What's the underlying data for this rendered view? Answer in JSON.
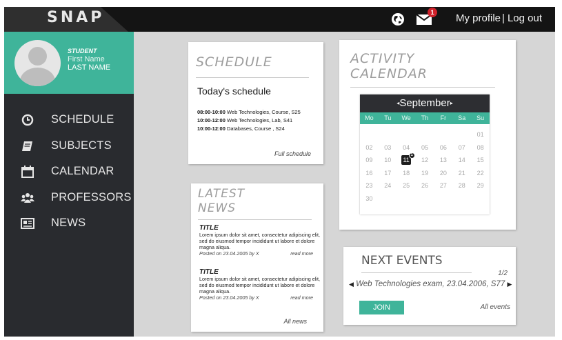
{
  "header": {
    "logo": "SNAP",
    "notifications_count": "1",
    "my_profile": "My profile",
    "separator": "|",
    "logout": "Log out"
  },
  "profile": {
    "role": "STUDENT",
    "first_name": "First Name",
    "last_name": "LAST NAME"
  },
  "sidebar": {
    "items": [
      {
        "label": "SCHEDULE",
        "icon": "clock-icon"
      },
      {
        "label": "SUBJECTS",
        "icon": "book-icon"
      },
      {
        "label": "CALENDAR",
        "icon": "calendar-icon"
      },
      {
        "label": "PROFESSORS",
        "icon": "people-icon"
      },
      {
        "label": "NEWS",
        "icon": "newspaper-icon"
      }
    ]
  },
  "schedule": {
    "title": "SCHEDULE",
    "subtitle": "Today's schedule",
    "entries": [
      {
        "time": "08:00-10:00",
        "text": " Web Technologies, Course, S25"
      },
      {
        "time": "10:00-12:00",
        "text": " Web Technologies, Lab, S41"
      },
      {
        "time": "10:00-12:00",
        "text": " Databases, Course , S24"
      }
    ],
    "link": "Full schedule"
  },
  "news": {
    "title_line1": "LATEST",
    "title_line2": "NEWS",
    "items": [
      {
        "title": "TITLE",
        "body": "Lorem ipsum dolor sit amet, consectetur adipiscing elit, sed do eiusmod tempor incididunt ut labore et dolore magna aliqua.",
        "posted": "Posted on 23.04.2005 by X",
        "read_more": "read more"
      },
      {
        "title": "TITLE",
        "body": "Lorem ipsum dolor sit amet, consectetur adipiscing elit, sed do eiusmod tempor incididunt ut labore et dolore magna aliqua.",
        "posted": "Posted on 23.04.2005 by X",
        "read_more": "read more"
      }
    ],
    "link": "All news"
  },
  "calendar": {
    "title_line1": "ACTIVITY",
    "title_line2": "CALENDAR",
    "month": "September",
    "prev": "◂",
    "next": "▸",
    "weekdays": [
      "Mo",
      "Tu",
      "We",
      "Th",
      "Fr",
      "Sa",
      "Su"
    ],
    "days": [
      "",
      "",
      "",
      "",
      "",
      "",
      "01",
      "02",
      "03",
      "04",
      "05",
      "06",
      "07",
      "08",
      "09",
      "10",
      "11",
      "12",
      "13",
      "14",
      "15",
      "16",
      "17",
      "18",
      "19",
      "20",
      "21",
      "22",
      "23",
      "24",
      "25",
      "26",
      "27",
      "28",
      "29",
      "30"
    ],
    "today": "11",
    "today_badge": "1"
  },
  "events": {
    "title": "NEXT EVENTS",
    "page": "1/2",
    "event": "Web Technologies exam, 23.04.2006, S77",
    "join": "JOIN",
    "link": "All events"
  },
  "colors": {
    "accent": "#3fb49a",
    "topbar": "#141414",
    "sidebar": "#292b2f",
    "badge": "#d0222b"
  }
}
